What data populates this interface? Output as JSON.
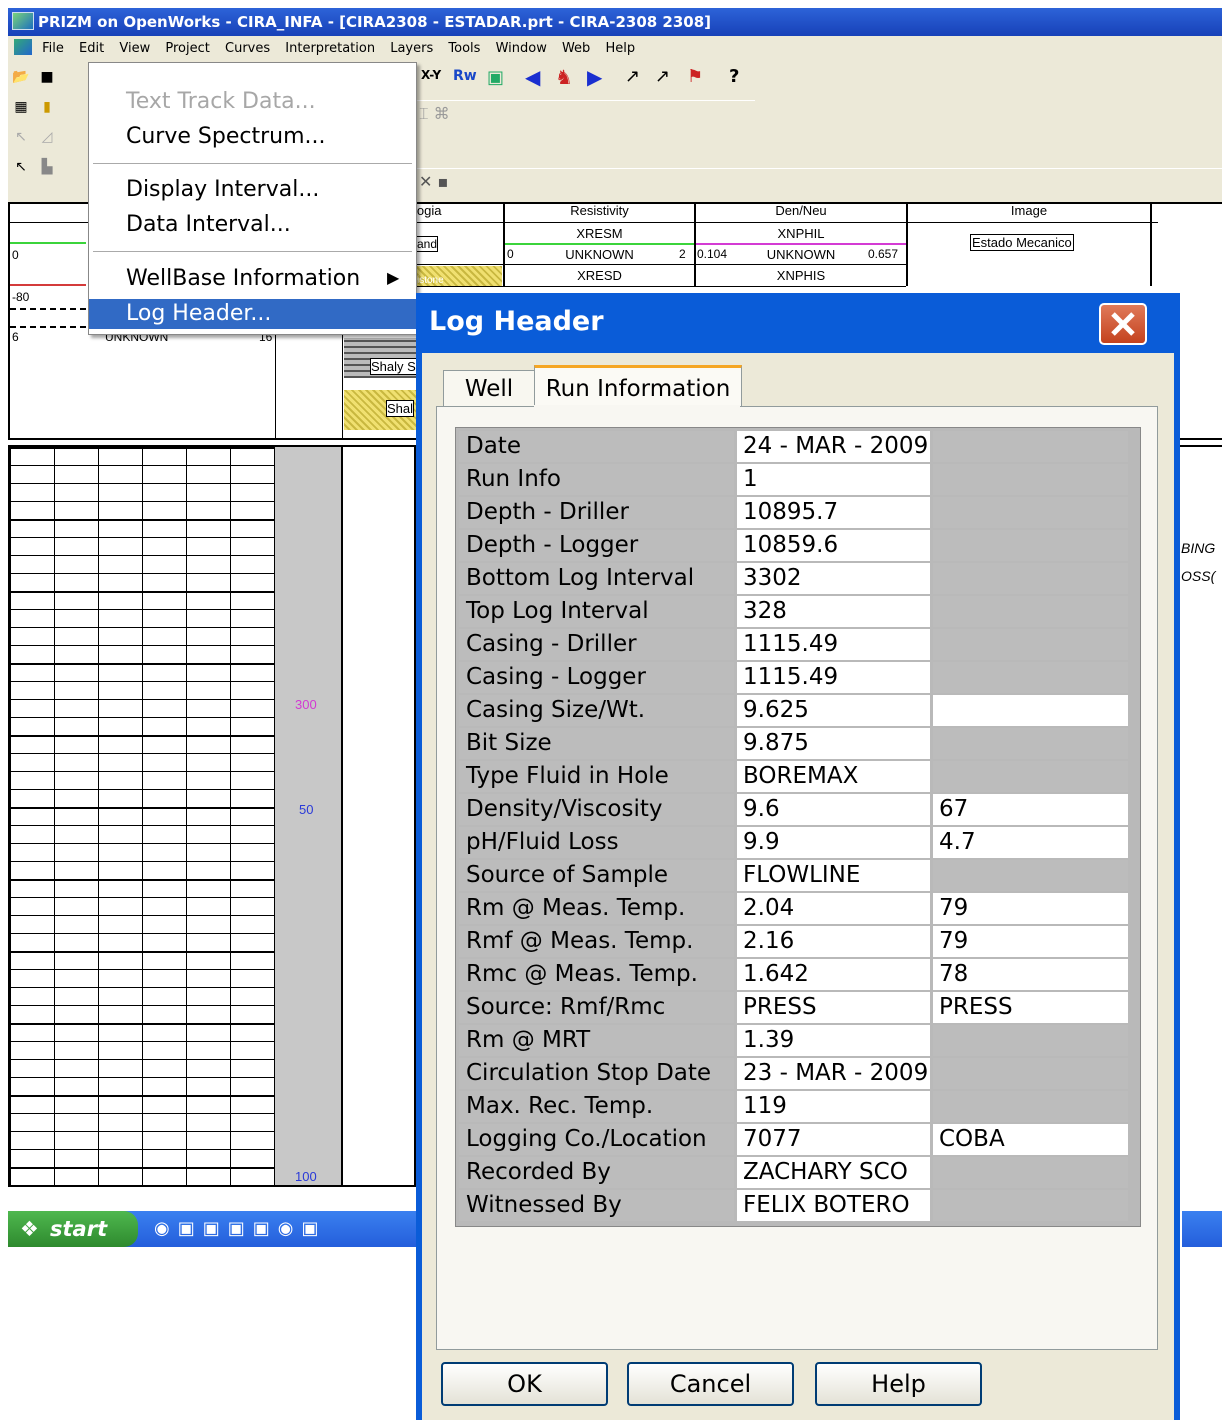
{
  "window": {
    "title": "PRIZM on OpenWorks - CIRA_INFA - [CIRA2308 - ESTADAR.prt - CIRA-2308 2308]"
  },
  "menubar": [
    "File",
    "Edit",
    "View",
    "Project",
    "Curves",
    "Interpretation",
    "Layers",
    "Tools",
    "Window",
    "Web",
    "Help"
  ],
  "toolbar": {
    "xy_label": "X-Y",
    "rw_label": "Rw"
  },
  "dropdown": {
    "items": [
      {
        "label": "Text Track Data...",
        "disabled": true
      },
      {
        "label": "Curve Spectrum..."
      },
      {
        "label": "Display Interval..."
      },
      {
        "label": "Data Interval..."
      },
      {
        "label": "WellBase Information",
        "submenu": true
      },
      {
        "label": "Log Header...",
        "selected": true
      }
    ],
    "submenu_arrow": "▶"
  },
  "tracks": {
    "headers": [
      "logia",
      "Resistivity",
      "Den/Neu",
      "Image"
    ],
    "resistivity": {
      "curve1": "XRESM",
      "unit": "UNKNOWN",
      "min": "0",
      "max": "2",
      "curve2": "XRESD"
    },
    "den_neu": {
      "curve1": "XNPHIL",
      "unit": "UNKNOWN",
      "min": "0.104",
      "max": "0.657",
      "curve2": "XNPHIS"
    },
    "image": {
      "label": "Estado Mecanico"
    },
    "left_scale": {
      "v0": "0",
      "v1": "-80",
      "v2": "6",
      "unit": "UNKNOWN",
      "v3": "16"
    },
    "litho": {
      "a": "and",
      "b": "istone",
      "c": "Shaly S",
      "d": "Shal"
    },
    "right_text": [
      "BING",
      "OSS("
    ],
    "depth_labels": {
      "a": "300",
      "b": "50",
      "c": "100"
    }
  },
  "taskbar": {
    "start_label": "start"
  },
  "dialog": {
    "title": "Log Header",
    "tabs": [
      {
        "label": "Well",
        "active": false
      },
      {
        "label": "Run Information",
        "active": true
      }
    ],
    "rows": [
      {
        "label": "Date",
        "value": "24 - MAR - 2009",
        "extra": ""
      },
      {
        "label": "Run Info",
        "value": "1",
        "extra": ""
      },
      {
        "label": "Depth - Driller",
        "value": "10895.7",
        "extra": ""
      },
      {
        "label": "Depth - Logger",
        "value": "10859.6",
        "extra": ""
      },
      {
        "label": "Bottom Log Interval",
        "value": "3302",
        "extra": ""
      },
      {
        "label": "Top Log Interval",
        "value": "328",
        "extra": ""
      },
      {
        "label": "Casing - Driller",
        "value": "1115.49",
        "extra": ""
      },
      {
        "label": "Casing -  Logger",
        "value": "1115.49",
        "extra": ""
      },
      {
        "label": "Casing Size/Wt.",
        "value": "9.625",
        "extra": "",
        "extra_white": true
      },
      {
        "label": "Bit Size",
        "value": "9.875",
        "extra": ""
      },
      {
        "label": "Type Fluid in Hole",
        "value": "BOREMAX",
        "extra": ""
      },
      {
        "label": "Density/Viscosity",
        "value": "9.6",
        "extra": "67",
        "extra_white": true
      },
      {
        "label": "pH/Fluid Loss",
        "value": "9.9",
        "extra": "4.7",
        "extra_white": true
      },
      {
        "label": "Source of Sample",
        "value": "FLOWLINE",
        "extra": ""
      },
      {
        "label": "Rm @ Meas. Temp.",
        "value": "2.04",
        "extra": "79",
        "extra_white": true
      },
      {
        "label": "Rmf @ Meas. Temp.",
        "value": "2.16",
        "extra": "79",
        "extra_white": true
      },
      {
        "label": "Rmc @ Meas. Temp.",
        "value": "1.642",
        "extra": "78",
        "extra_white": true
      },
      {
        "label": "Source: Rmf/Rmc",
        "value": "PRESS",
        "extra": "PRESS",
        "extra_white": true
      },
      {
        "label": "Rm @ MRT",
        "value": "1.39",
        "extra": ""
      },
      {
        "label": "Circulation Stop Date",
        "value": "23 - MAR - 2009",
        "extra": ""
      },
      {
        "label": "Max. Rec. Temp.",
        "value": "119",
        "extra": ""
      },
      {
        "label": "Logging Co./Location",
        "value": "7077",
        "extra": "COBA",
        "extra_white": true
      },
      {
        "label": "Recorded By",
        "value": "ZACHARY SCO",
        "extra": ""
      },
      {
        "label": "Witnessed By",
        "value": "FELIX BOTERO",
        "extra": ""
      }
    ],
    "buttons": {
      "ok": "OK",
      "cancel": "Cancel",
      "help": "Help"
    }
  }
}
